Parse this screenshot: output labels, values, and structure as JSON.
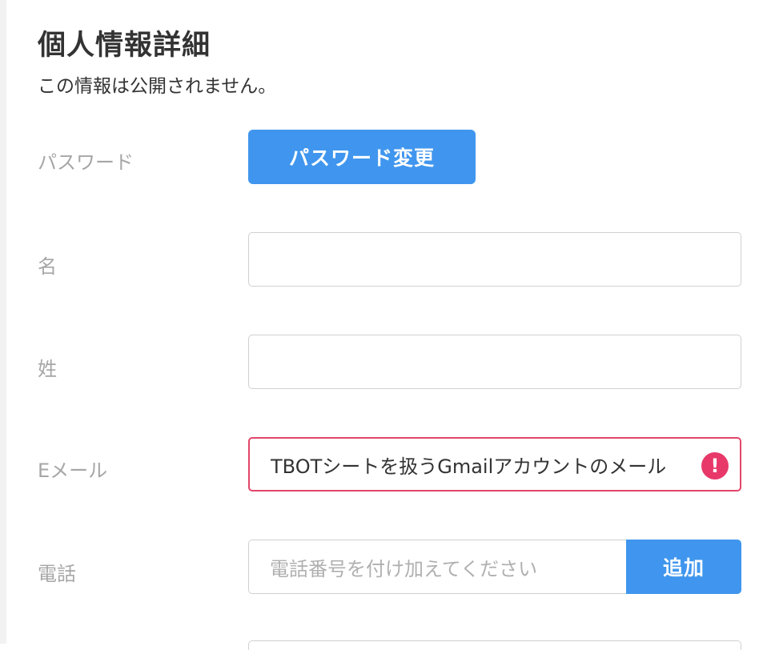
{
  "section": {
    "title": "個人情報詳細",
    "subtitle": "この情報は公開されません。"
  },
  "fields": {
    "password": {
      "label": "パスワード",
      "button_label": "パスワード変更"
    },
    "first_name": {
      "label": "名",
      "value": ""
    },
    "last_name": {
      "label": "姓",
      "value": ""
    },
    "email": {
      "label": "Eメール",
      "value": "TBOTシートを扱うGmailアカウントのメール",
      "status": "error",
      "error_icon": "exclamation-icon",
      "error_icon_glyph": "!",
      "error_color": "#e8386a"
    },
    "phone": {
      "label": "電話",
      "placeholder": "電話番号を付け加えてください",
      "add_button_label": "追加"
    }
  },
  "colors": {
    "accent": "#4096ee",
    "error": "#e2466a",
    "label_gray": "#a6a6a6",
    "heading": "#333333"
  }
}
